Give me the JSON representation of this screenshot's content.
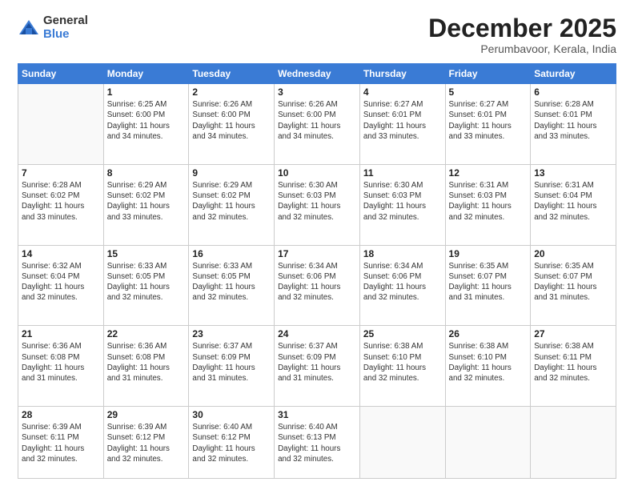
{
  "logo": {
    "general": "General",
    "blue": "Blue"
  },
  "header": {
    "month": "December 2025",
    "location": "Perumbavoor, Kerala, India"
  },
  "weekdays": [
    "Sunday",
    "Monday",
    "Tuesday",
    "Wednesday",
    "Thursday",
    "Friday",
    "Saturday"
  ],
  "weeks": [
    [
      {
        "day": "",
        "info": ""
      },
      {
        "day": "1",
        "info": "Sunrise: 6:25 AM\nSunset: 6:00 PM\nDaylight: 11 hours\nand 34 minutes."
      },
      {
        "day": "2",
        "info": "Sunrise: 6:26 AM\nSunset: 6:00 PM\nDaylight: 11 hours\nand 34 minutes."
      },
      {
        "day": "3",
        "info": "Sunrise: 6:26 AM\nSunset: 6:00 PM\nDaylight: 11 hours\nand 34 minutes."
      },
      {
        "day": "4",
        "info": "Sunrise: 6:27 AM\nSunset: 6:01 PM\nDaylight: 11 hours\nand 33 minutes."
      },
      {
        "day": "5",
        "info": "Sunrise: 6:27 AM\nSunset: 6:01 PM\nDaylight: 11 hours\nand 33 minutes."
      },
      {
        "day": "6",
        "info": "Sunrise: 6:28 AM\nSunset: 6:01 PM\nDaylight: 11 hours\nand 33 minutes."
      }
    ],
    [
      {
        "day": "7",
        "info": "Sunrise: 6:28 AM\nSunset: 6:02 PM\nDaylight: 11 hours\nand 33 minutes."
      },
      {
        "day": "8",
        "info": "Sunrise: 6:29 AM\nSunset: 6:02 PM\nDaylight: 11 hours\nand 33 minutes."
      },
      {
        "day": "9",
        "info": "Sunrise: 6:29 AM\nSunset: 6:02 PM\nDaylight: 11 hours\nand 32 minutes."
      },
      {
        "day": "10",
        "info": "Sunrise: 6:30 AM\nSunset: 6:03 PM\nDaylight: 11 hours\nand 32 minutes."
      },
      {
        "day": "11",
        "info": "Sunrise: 6:30 AM\nSunset: 6:03 PM\nDaylight: 11 hours\nand 32 minutes."
      },
      {
        "day": "12",
        "info": "Sunrise: 6:31 AM\nSunset: 6:03 PM\nDaylight: 11 hours\nand 32 minutes."
      },
      {
        "day": "13",
        "info": "Sunrise: 6:31 AM\nSunset: 6:04 PM\nDaylight: 11 hours\nand 32 minutes."
      }
    ],
    [
      {
        "day": "14",
        "info": "Sunrise: 6:32 AM\nSunset: 6:04 PM\nDaylight: 11 hours\nand 32 minutes."
      },
      {
        "day": "15",
        "info": "Sunrise: 6:33 AM\nSunset: 6:05 PM\nDaylight: 11 hours\nand 32 minutes."
      },
      {
        "day": "16",
        "info": "Sunrise: 6:33 AM\nSunset: 6:05 PM\nDaylight: 11 hours\nand 32 minutes."
      },
      {
        "day": "17",
        "info": "Sunrise: 6:34 AM\nSunset: 6:06 PM\nDaylight: 11 hours\nand 32 minutes."
      },
      {
        "day": "18",
        "info": "Sunrise: 6:34 AM\nSunset: 6:06 PM\nDaylight: 11 hours\nand 32 minutes."
      },
      {
        "day": "19",
        "info": "Sunrise: 6:35 AM\nSunset: 6:07 PM\nDaylight: 11 hours\nand 31 minutes."
      },
      {
        "day": "20",
        "info": "Sunrise: 6:35 AM\nSunset: 6:07 PM\nDaylight: 11 hours\nand 31 minutes."
      }
    ],
    [
      {
        "day": "21",
        "info": "Sunrise: 6:36 AM\nSunset: 6:08 PM\nDaylight: 11 hours\nand 31 minutes."
      },
      {
        "day": "22",
        "info": "Sunrise: 6:36 AM\nSunset: 6:08 PM\nDaylight: 11 hours\nand 31 minutes."
      },
      {
        "day": "23",
        "info": "Sunrise: 6:37 AM\nSunset: 6:09 PM\nDaylight: 11 hours\nand 31 minutes."
      },
      {
        "day": "24",
        "info": "Sunrise: 6:37 AM\nSunset: 6:09 PM\nDaylight: 11 hours\nand 31 minutes."
      },
      {
        "day": "25",
        "info": "Sunrise: 6:38 AM\nSunset: 6:10 PM\nDaylight: 11 hours\nand 32 minutes."
      },
      {
        "day": "26",
        "info": "Sunrise: 6:38 AM\nSunset: 6:10 PM\nDaylight: 11 hours\nand 32 minutes."
      },
      {
        "day": "27",
        "info": "Sunrise: 6:38 AM\nSunset: 6:11 PM\nDaylight: 11 hours\nand 32 minutes."
      }
    ],
    [
      {
        "day": "28",
        "info": "Sunrise: 6:39 AM\nSunset: 6:11 PM\nDaylight: 11 hours\nand 32 minutes."
      },
      {
        "day": "29",
        "info": "Sunrise: 6:39 AM\nSunset: 6:12 PM\nDaylight: 11 hours\nand 32 minutes."
      },
      {
        "day": "30",
        "info": "Sunrise: 6:40 AM\nSunset: 6:12 PM\nDaylight: 11 hours\nand 32 minutes."
      },
      {
        "day": "31",
        "info": "Sunrise: 6:40 AM\nSunset: 6:13 PM\nDaylight: 11 hours\nand 32 minutes."
      },
      {
        "day": "",
        "info": ""
      },
      {
        "day": "",
        "info": ""
      },
      {
        "day": "",
        "info": ""
      }
    ]
  ]
}
